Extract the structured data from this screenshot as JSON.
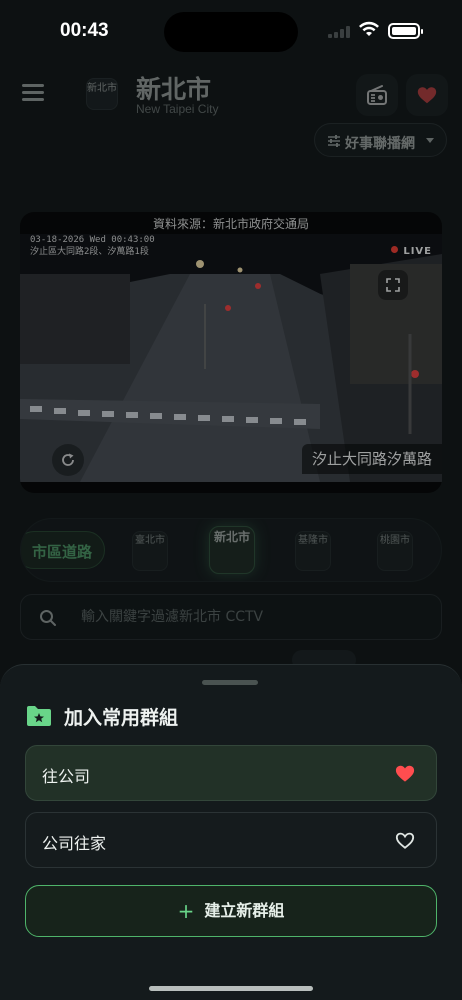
{
  "status_bar": {
    "time": "00:43"
  },
  "header": {
    "city_badge": "新北市",
    "city_name": "新北市",
    "city_name_en": "New Taipei City",
    "station_selector": "好事聯播網"
  },
  "camera": {
    "source_label": "資料來源：新北市政府交通局",
    "timestamp_overlay": "03-18-2026 Wed 00:43:00",
    "location_overlay": "汐止區大同路2段、汐萬路1段",
    "live_label": "LIVE",
    "name": "汐止大同路汐萬路"
  },
  "city_tabs": {
    "active_chip": "市區道路",
    "tabs": [
      "臺北市",
      "新北市",
      "基隆市",
      "桃園市"
    ]
  },
  "search": {
    "placeholder": "輸入關鍵字過濾新北市 CCTV"
  },
  "sheet": {
    "title": "加入常用群組",
    "groups": [
      {
        "name": "往公司",
        "favorited": true
      },
      {
        "name": "公司往家",
        "favorited": false
      }
    ],
    "create_label": "建立新群組"
  },
  "colors": {
    "accent": "#69d589",
    "favorite": "#ff4d4f",
    "background": "#0d1112"
  }
}
